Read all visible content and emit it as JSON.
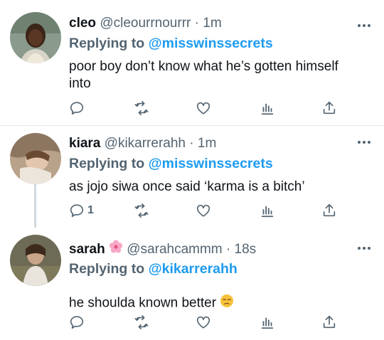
{
  "tweets": [
    {
      "name": "cleo",
      "handle": "@cleourrnourrr",
      "separator": "·",
      "time": "1m",
      "replying_prefix": "Replying to",
      "replying_to": "@misswinssecrets",
      "text": "poor boy don’t know what he’s gotten himself into",
      "reply_count": ""
    },
    {
      "name": "kiara",
      "handle": "@kikarrerahh",
      "separator": "·",
      "time": "1m",
      "replying_prefix": "Replying to",
      "replying_to": "@misswinssecrets",
      "text": "as jojo siwa once said ‘karma is a bitch’",
      "reply_count": "1"
    },
    {
      "name": "sarah",
      "name_emoji": "cherry-blossom-emoji",
      "handle": "@sarahcammm",
      "separator": "·",
      "time": "18s",
      "replying_prefix": "Replying to",
      "replying_to": "@kikarrerahh",
      "text": "he shoulda known better",
      "text_emoji": "unamused-face-emoji",
      "reply_count": ""
    }
  ],
  "colors": {
    "accent": "#1d9bf0",
    "secondary_text": "#536471",
    "divider": "#e1e8ed",
    "thread_line": "#cfd9de"
  },
  "icons": [
    "reply-icon",
    "retweet-icon",
    "like-icon",
    "analytics-icon",
    "share-icon",
    "more-icon"
  ]
}
